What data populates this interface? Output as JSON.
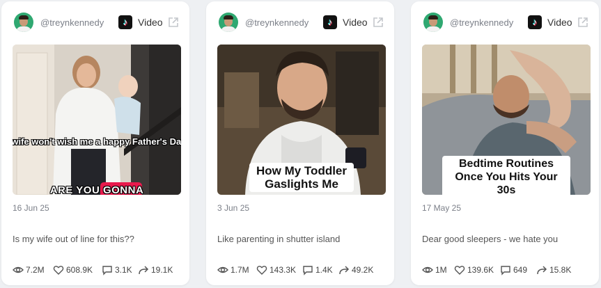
{
  "posts": [
    {
      "handle": "@treynkennedy",
      "platform_label": "Video",
      "thumbnail_caption": "My wife won't wish me a happy Father's Day??",
      "thumbnail_overlay": "ARE YOU GONNA",
      "date": "16 Jun 25",
      "description": "Is my wife out of line for this??",
      "views": "7.2M",
      "likes": "608.9K",
      "comments": "3.1K",
      "shares": "19.1K"
    },
    {
      "handle": "@treynkennedy",
      "platform_label": "Video",
      "thumbnail_caption": "How My Toddler Gaslights Me",
      "date": "3 Jun 25",
      "description": "Like parenting in shutter island",
      "views": "1.7M",
      "likes": "143.3K",
      "comments": "1.4K",
      "shares": "49.2K"
    },
    {
      "handle": "@treynkennedy",
      "platform_label": "Video",
      "thumbnail_caption": "Bedtime Routines Once You Hits Your 30s",
      "date": "17 May 25",
      "description": "Dear good sleepers - we hate you",
      "views": "1M",
      "likes": "139.6K",
      "comments": "649",
      "shares": "15.8K"
    }
  ],
  "icons": {
    "platform": "tiktok-icon",
    "external": "external-link-icon",
    "views": "eye-icon",
    "likes": "heart-icon",
    "comments": "comment-icon",
    "shares": "share-icon"
  },
  "colors": {
    "background": "#eef0f3",
    "card": "#ffffff",
    "muted_text": "#7b7f88",
    "avatar_bg": "#2fa871",
    "overlay_accent": "#e8194c"
  }
}
